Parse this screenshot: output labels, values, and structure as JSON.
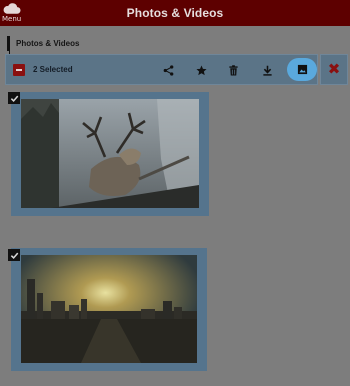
{
  "header": {
    "menu_label": "Menu",
    "title": "Photos & Videos"
  },
  "breadcrumb": {
    "label": "Photos & Videos"
  },
  "selection_toolbar": {
    "count_label": "2 Selected",
    "actions": [
      "share-icon",
      "star-icon",
      "trash-icon",
      "download-icon",
      "image-icon"
    ],
    "active_action": "image-icon"
  },
  "close": {
    "label": "✖"
  },
  "photos": [
    {
      "subject": "stag",
      "selected": true
    },
    {
      "subject": "city sunset",
      "selected": true
    }
  ],
  "colors": {
    "header": "#5d0000",
    "toolbar": "#5b7487",
    "accent": "#5aa9dd",
    "danger": "#8a1010"
  }
}
